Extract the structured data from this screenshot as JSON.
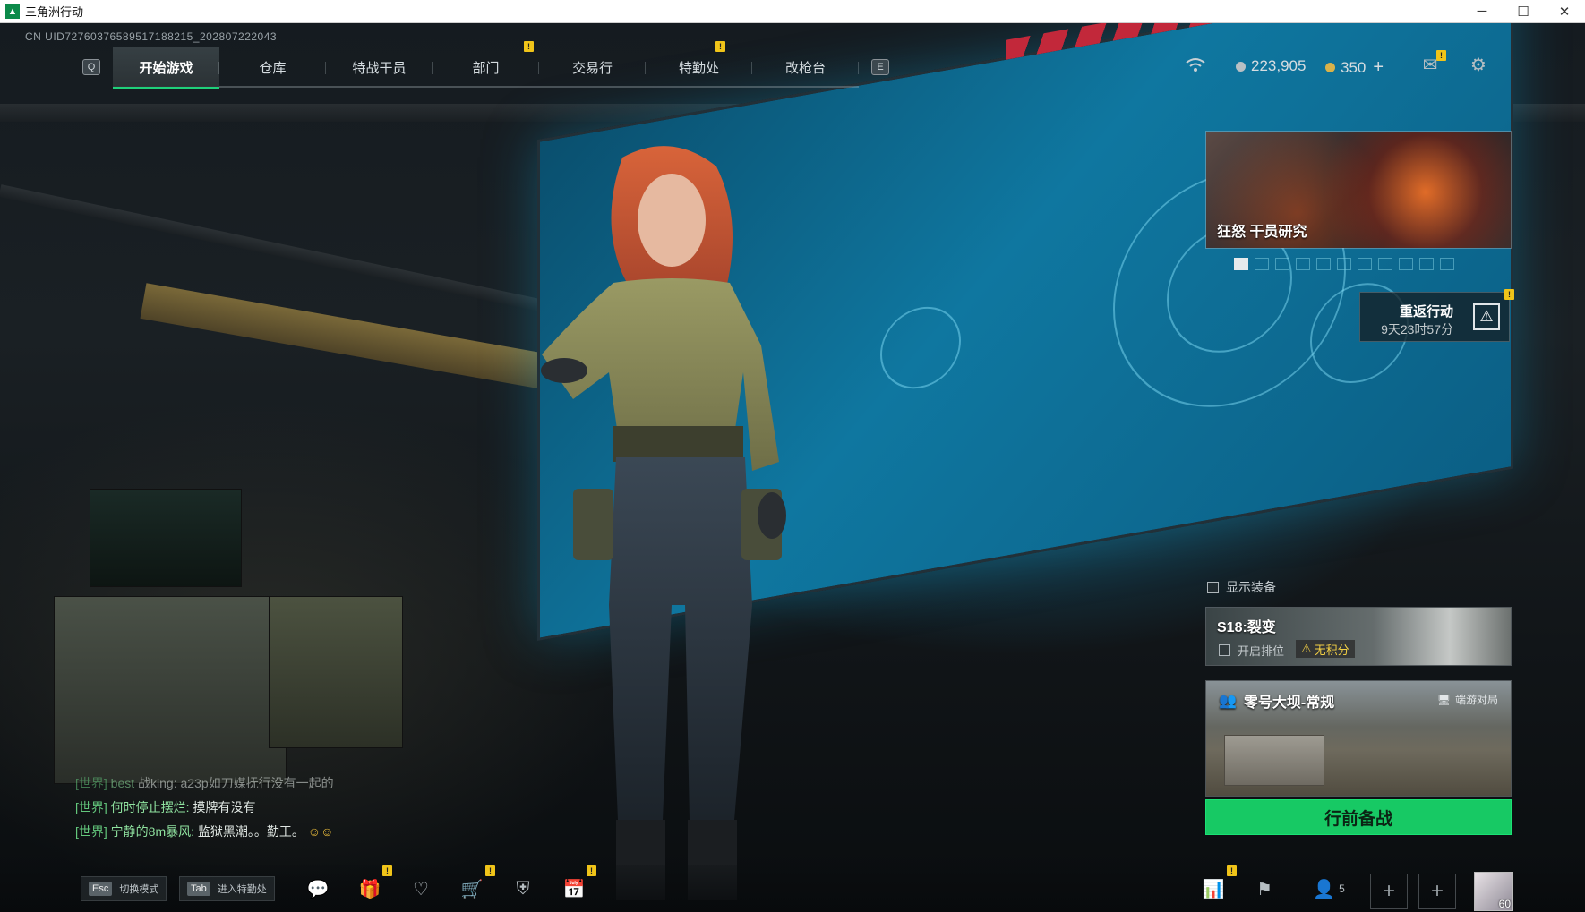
{
  "window": {
    "title": "三角洲行动"
  },
  "uid": "CN UID72760376589517188215_202807222043",
  "nav": {
    "left_key": "Q",
    "right_key": "E",
    "tabs": [
      {
        "label": "开始游戏",
        "active": true
      },
      {
        "label": "仓库"
      },
      {
        "label": "特战干员"
      },
      {
        "label": "部门"
      },
      {
        "label": "交易行"
      },
      {
        "label": "特勤处"
      },
      {
        "label": "改枪台"
      }
    ]
  },
  "currency": {
    "silver": "223,905",
    "gold": "350",
    "gold_add": "+"
  },
  "banner": {
    "title": "狂怒 干员研究"
  },
  "return_event": {
    "title": "重返行动",
    "time": "9天23时57分"
  },
  "show_gear": "显示装备",
  "season": {
    "title": "S18:裂变",
    "ranked_toggle": "开启排位",
    "warn": "无积分"
  },
  "mode": {
    "title": "零号大坝-常规",
    "sub": "端游对局"
  },
  "deploy_button": "行前备战",
  "chat": [
    {
      "channel": "[世界]",
      "name": "best",
      "msg": "战king: a23p如刀媒抚行没有一起的",
      "faded": true
    },
    {
      "channel": "[世界]",
      "name": "何时停止摆烂:",
      "msg": "摸牌有没有"
    },
    {
      "channel": "[世界]",
      "name": "宁静的8m暴风:",
      "msg": "监狱黑潮。。勤王。"
    }
  ],
  "bottom": {
    "esc_key": "Esc",
    "esc_label": "切换模式",
    "tab_key": "Tab",
    "tab_label": "进入特勤处",
    "squad_count": "5",
    "avatar_level": "60"
  },
  "colors": {
    "accent_green": "#17c964",
    "alert_yellow": "#f0c419"
  },
  "icons": [
    "wifi-icon",
    "mail-icon",
    "settings-icon",
    "chat-icon",
    "gift-icon",
    "heart-icon",
    "cart-icon",
    "shield-icon",
    "calendar-icon",
    "stats-icon",
    "flag-icon",
    "friends-icon"
  ]
}
